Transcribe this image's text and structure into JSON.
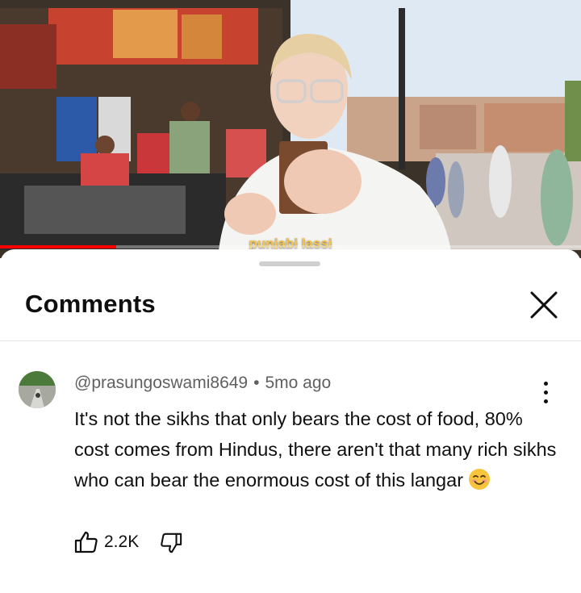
{
  "video": {
    "caption": "punjabi lassi",
    "progress_fraction": 0.2
  },
  "comments_panel": {
    "title": "Comments",
    "close_icon": "close-icon"
  },
  "comment": {
    "author": "@prasungoswami8649",
    "separator": "•",
    "time": "5mo ago",
    "text": "It's not the sikhs that only bears the cost of food, 80% cost comes from Hindus, there aren't that many rich sikhs who can bear the enormous cost of this langar",
    "emoji_icon": "smiling-face-icon",
    "likes": "2.2K",
    "like_icon": "thumbs-up-icon",
    "dislike_icon": "thumbs-down-icon",
    "menu_icon": "more-vertical-icon"
  },
  "colors": {
    "progress": "#ff0000",
    "caption": "#f4c54a",
    "meta_text": "#606060",
    "text": "#0f0f0f"
  }
}
